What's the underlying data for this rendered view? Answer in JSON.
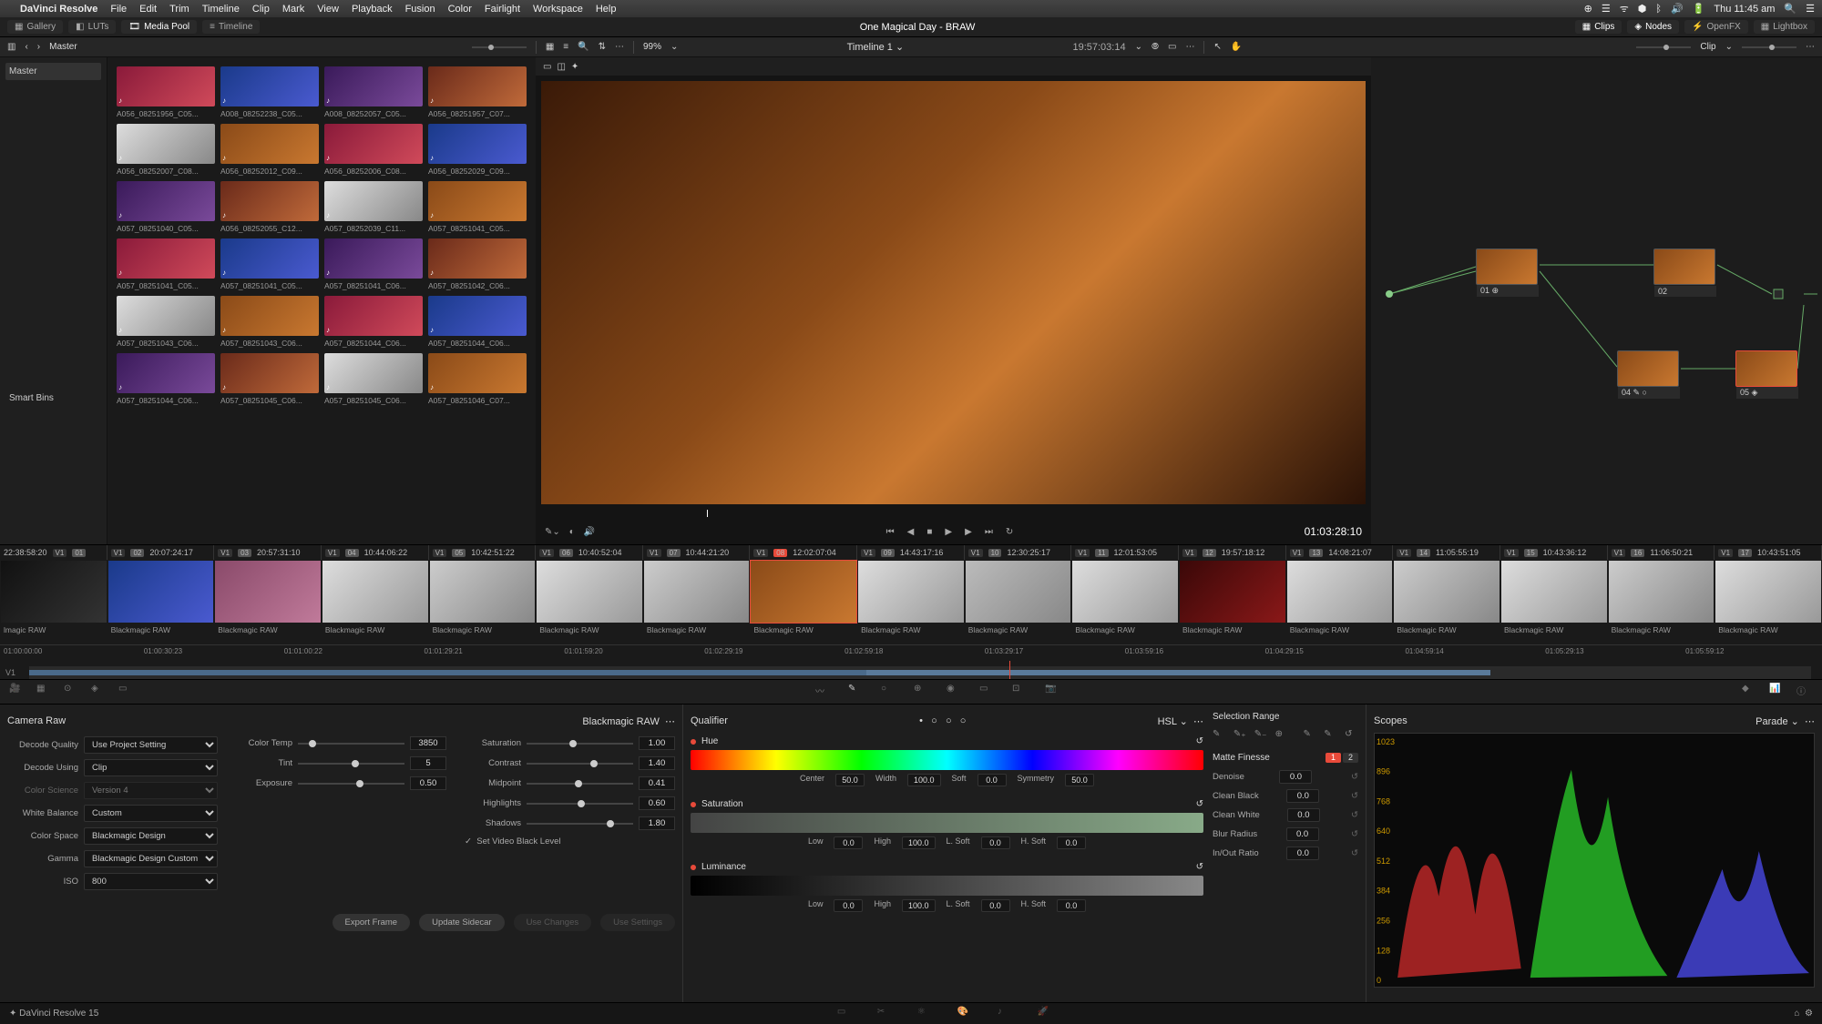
{
  "menubar": {
    "app": "DaVinci Resolve",
    "items": [
      "File",
      "Edit",
      "Trim",
      "Timeline",
      "Clip",
      "Mark",
      "View",
      "Playback",
      "Fusion",
      "Color",
      "Fairlight",
      "Workspace",
      "Help"
    ],
    "time": "Thu 11:45 am"
  },
  "secondbar": {
    "gallery": "Gallery",
    "luts": "LUTs",
    "mediapool": "Media Pool",
    "timeline": "Timeline",
    "title": "One Magical Day - BRAW",
    "clips": "Clips",
    "nodes": "Nodes",
    "openfx": "OpenFX",
    "lightbox": "Lightbox"
  },
  "toolbar": {
    "master": "Master",
    "zoom": "99%",
    "timeline_name": "Timeline 1",
    "src_tc": "19:57:03:14",
    "clip": "Clip"
  },
  "library": {
    "master": "Master",
    "smartbins": "Smart Bins"
  },
  "clips": [
    "A056_08251956_C05...",
    "A008_08252238_C05...",
    "A008_08252057_C05...",
    "A056_08251957_C07...",
    "A056_08252007_C08...",
    "A056_08252012_C09...",
    "A056_08252006_C08...",
    "A056_08252029_C09...",
    "A057_08251040_C05...",
    "A056_08252055_C12...",
    "A057_08252039_C11...",
    "A057_08251041_C05...",
    "A057_08251041_C05...",
    "A057_08251041_C05...",
    "A057_08251041_C06...",
    "A057_08251042_C06...",
    "A057_08251043_C06...",
    "A057_08251043_C06...",
    "A057_08251044_C06...",
    "A057_08251044_C06...",
    "A057_08251044_C06...",
    "A057_08251045_C06...",
    "A057_08251045_C06...",
    "A057_08251046_C07..."
  ],
  "viewer": {
    "rec_tc": "01:03:28:10"
  },
  "nodes": [
    {
      "id": "01",
      "label": "01"
    },
    {
      "id": "02",
      "label": "02"
    },
    {
      "id": "04",
      "label": "04"
    },
    {
      "id": "05",
      "label": "05"
    }
  ],
  "filmstrip": {
    "cells": [
      {
        "n": "01",
        "tc": "22:38:58:20"
      },
      {
        "n": "02",
        "tc": "20:07:24:17"
      },
      {
        "n": "03",
        "tc": "20:57:31:10"
      },
      {
        "n": "04",
        "tc": "10:44:06:22"
      },
      {
        "n": "05",
        "tc": "10:42:51:22"
      },
      {
        "n": "06",
        "tc": "10:40:52:04"
      },
      {
        "n": "07",
        "tc": "10:44:21:20"
      },
      {
        "n": "08",
        "tc": "12:02:07:04"
      },
      {
        "n": "09",
        "tc": "14:43:17:16"
      },
      {
        "n": "10",
        "tc": "12:30:25:17"
      },
      {
        "n": "11",
        "tc": "12:01:53:05"
      },
      {
        "n": "12",
        "tc": "19:57:18:12"
      },
      {
        "n": "13",
        "tc": "14:08:21:07"
      },
      {
        "n": "14",
        "tc": "11:05:55:19"
      },
      {
        "n": "15",
        "tc": "10:43:36:12"
      },
      {
        "n": "16",
        "tc": "11:06:50:21"
      },
      {
        "n": "17",
        "tc": "10:43:51:05"
      }
    ],
    "codec": "Blackmagic RAW",
    "ruler": [
      "01:00:00:00",
      "01:00:30:23",
      "01:01:00:22",
      "01:01:29:21",
      "01:01:59:20",
      "01:02:29:19",
      "01:02:59:18",
      "01:03:29:17",
      "01:03:59:16",
      "01:04:29:15",
      "01:04:59:14",
      "01:05:29:13",
      "01:05:59:12"
    ],
    "track": "V1"
  },
  "camraw": {
    "title": "Camera Raw",
    "profile": "Blackmagic RAW",
    "fields": {
      "decode_quality": {
        "label": "Decode Quality",
        "value": "Use Project Setting"
      },
      "decode_using": {
        "label": "Decode Using",
        "value": "Clip"
      },
      "color_science": {
        "label": "Color Science",
        "value": "Version 4"
      },
      "white_balance": {
        "label": "White Balance",
        "value": "Custom"
      },
      "color_space": {
        "label": "Color Space",
        "value": "Blackmagic Design"
      },
      "gamma": {
        "label": "Gamma",
        "value": "Blackmagic Design Custom"
      },
      "iso": {
        "label": "ISO",
        "value": "800"
      }
    },
    "sliders1": {
      "color_temp": {
        "label": "Color Temp",
        "value": "3850"
      },
      "tint": {
        "label": "Tint",
        "value": "5"
      },
      "exposure": {
        "label": "Exposure",
        "value": "0.50"
      }
    },
    "sliders2": {
      "saturation": {
        "label": "Saturation",
        "value": "1.00"
      },
      "contrast": {
        "label": "Contrast",
        "value": "1.40"
      },
      "midpoint": {
        "label": "Midpoint",
        "value": "0.41"
      },
      "highlights": {
        "label": "Highlights",
        "value": "0.60"
      },
      "shadows": {
        "label": "Shadows",
        "value": "1.80"
      }
    },
    "checkbox": "Set Video Black Level",
    "buttons": {
      "export": "Export Frame",
      "update": "Update Sidecar",
      "usechanges": "Use Changes",
      "usesettings": "Use Settings"
    }
  },
  "qualifier": {
    "title": "Qualifier",
    "mode": "HSL",
    "hue": {
      "title": "Hue",
      "center": "50.0",
      "width": "100.0",
      "soft": "0.0",
      "sym": "50.0",
      "center_l": "Center",
      "width_l": "Width",
      "soft_l": "Soft",
      "sym_l": "Symmetry"
    },
    "sat": {
      "title": "Saturation",
      "low": "0.0",
      "high": "100.0",
      "lsoft": "0.0",
      "hsoft": "0.0",
      "low_l": "Low",
      "high_l": "High",
      "lsoft_l": "L. Soft",
      "hsoft_l": "H. Soft"
    },
    "lum": {
      "title": "Luminance",
      "low": "0.0",
      "high": "100.0",
      "lsoft": "0.0",
      "hsoft": "0.0",
      "low_l": "Low",
      "high_l": "High",
      "lsoft_l": "L. Soft",
      "hsoft_l": "H. Soft"
    },
    "selrange": "Selection Range",
    "finesse": {
      "title": "Matte Finesse",
      "tab1": "1",
      "tab2": "2",
      "denoise": {
        "label": "Denoise",
        "value": "0.0"
      },
      "cleanblack": {
        "label": "Clean Black",
        "value": "0.0"
      },
      "cleanwhite": {
        "label": "Clean White",
        "value": "0.0"
      },
      "blur": {
        "label": "Blur Radius",
        "value": "0.0"
      },
      "inout": {
        "label": "In/Out Ratio",
        "value": "0.0"
      }
    }
  },
  "scopes": {
    "title": "Scopes",
    "mode": "Parade",
    "yticks": [
      "1023",
      "896",
      "768",
      "640",
      "512",
      "384",
      "256",
      "128",
      "0"
    ]
  },
  "footer": {
    "version": "DaVinci Resolve 15",
    "codec_short": "lmagic RAW"
  }
}
